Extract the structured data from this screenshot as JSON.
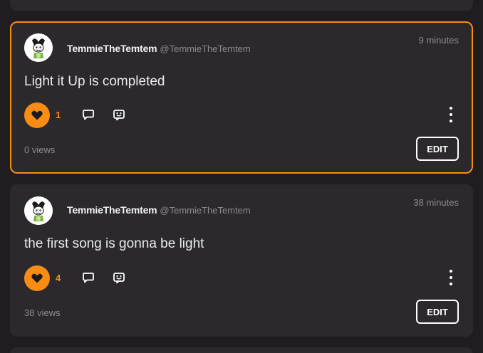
{
  "theme": {
    "accent": "#f98c12",
    "card_background": "#2c292d",
    "page_background": "#1f1d20"
  },
  "posts": [
    {
      "display_name": "TemmieTheTemtem",
      "handle": "@TemmieTheTemtem",
      "timestamp": "9 minutes",
      "text": "Light it Up is completed",
      "like_count": "1",
      "liked": true,
      "views": "0 views",
      "edit_label": "EDIT",
      "highlighted": true,
      "icons": [
        "heart-icon",
        "comment-icon",
        "share-icon",
        "more-vertical-icon"
      ]
    },
    {
      "display_name": "TemmieTheTemtem",
      "handle": "@TemmieTheTemtem",
      "timestamp": "38 minutes",
      "text": "the first song is gonna be light",
      "like_count": "4",
      "liked": true,
      "views": "38 views",
      "edit_label": "EDIT",
      "highlighted": false,
      "icons": [
        "heart-icon",
        "comment-icon",
        "share-icon",
        "more-vertical-icon"
      ]
    }
  ]
}
